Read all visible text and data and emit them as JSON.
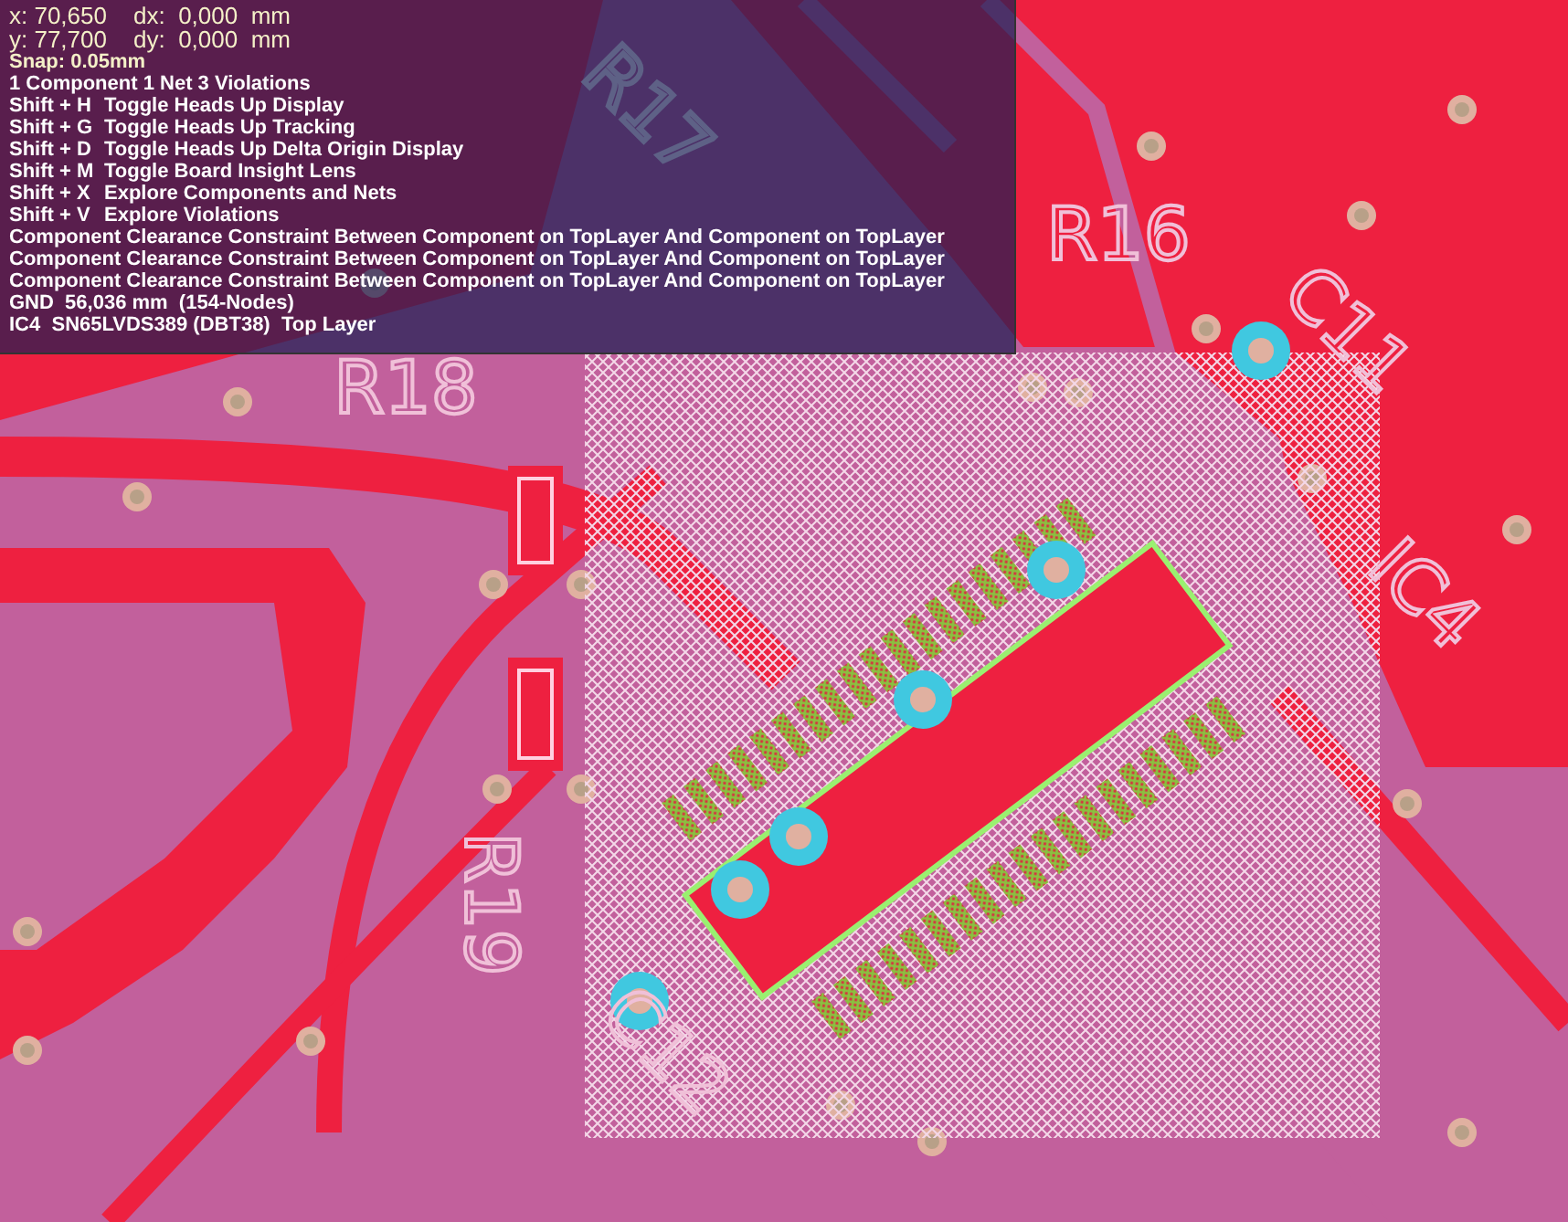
{
  "hud": {
    "cursor": [
      {
        "position": "x: 70,650",
        "delta": "dx:  0,000  mm"
      },
      {
        "position": "y: 77,700",
        "delta": "dy:  0,000  mm"
      }
    ],
    "snap": "Snap: 0.05mm",
    "summary": "1 Component 1 Net 3 Violations",
    "shortcuts": [
      {
        "keys": "Shift + H",
        "action": "Toggle Heads Up Display"
      },
      {
        "keys": "Shift + G",
        "action": "Toggle Heads Up Tracking"
      },
      {
        "keys": "Shift + D",
        "action": "Toggle Heads Up Delta Origin Display"
      },
      {
        "keys": "Shift + M",
        "action": "Toggle Board Insight Lens"
      },
      {
        "keys": "Shift + X",
        "action": "Explore Components and Nets"
      },
      {
        "keys": "Shift + V",
        "action": "Explore Violations"
      }
    ],
    "violations": [
      "Component Clearance Constraint Between Component on TopLayer And Component on TopLayer",
      "Component Clearance Constraint Between Component on TopLayer And Component on TopLayer",
      "Component Clearance Constraint Between Component on TopLayer And Component on TopLayer"
    ],
    "net": "GND  56,036 mm  (154-Nodes)",
    "component": "IC4  SN65LVDS389 (DBT38)  Top Layer"
  },
  "board": {
    "designators": [
      "R17",
      "R16",
      "C11",
      "R18",
      "IC4",
      "R19",
      "C12"
    ]
  }
}
